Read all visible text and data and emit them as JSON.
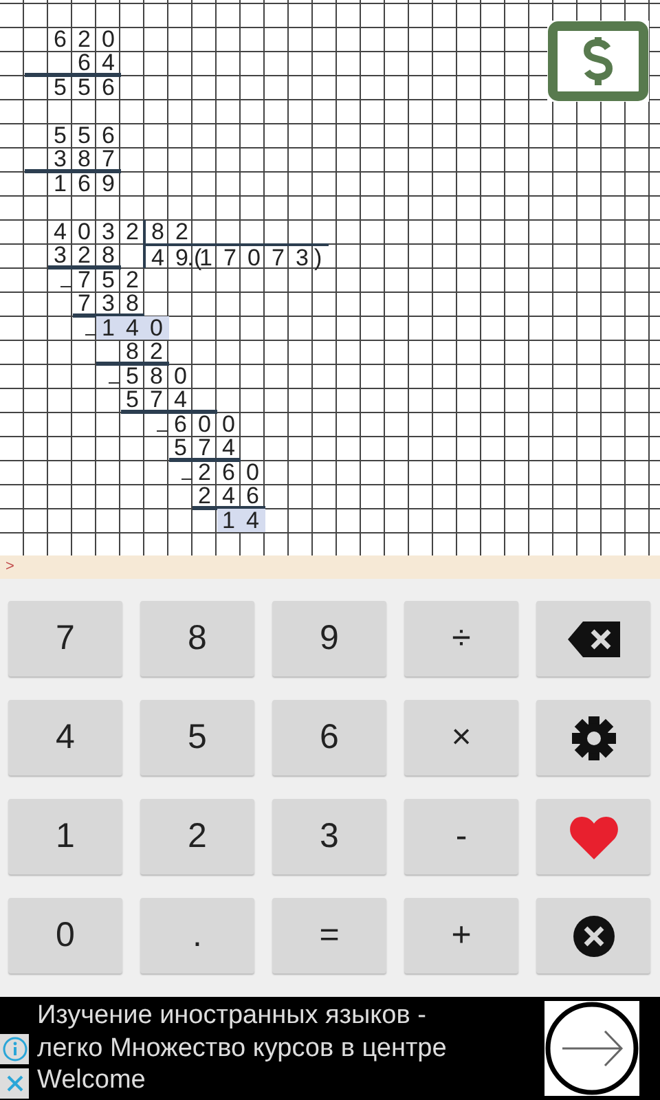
{
  "worksheet": {
    "rows": [
      {
        "kind": "blank"
      },
      {
        "kind": "line",
        "pieces": [
          {
            "text": "  6 2 0",
            "kind": "digits",
            "highlighted": false
          }
        ]
      },
      {
        "kind": "line",
        "pieces": [
          {
            "text": "   6 4",
            "kind": "digits",
            "highlighted": false
          }
        ],
        "underline": [
          false,
          true,
          true,
          true,
          true
        ]
      },
      {
        "kind": "line",
        "pieces": [
          {
            "text": "  5 5 6",
            "kind": "digits",
            "highlighted": false
          }
        ]
      },
      {
        "kind": "blank"
      },
      {
        "kind": "line",
        "pieces": [
          {
            "text": "  5 5 6",
            "kind": "digits",
            "highlighted": false
          }
        ]
      },
      {
        "kind": "line",
        "pieces": [
          {
            "text": "  3 8 7",
            "kind": "digits",
            "highlighted": false
          }
        ],
        "underline": [
          false,
          true,
          true,
          true,
          true
        ]
      },
      {
        "kind": "line",
        "pieces": [
          {
            "text": "  1 6 9",
            "kind": "digits",
            "highlighted": false
          }
        ]
      },
      {
        "kind": "blank"
      },
      {
        "kind": "line",
        "pieces": [
          {
            "text": "  4 0 3 2",
            "kind": "digits",
            "highlighted": false
          },
          {
            "text": "      8 2",
            "kind": "divisor",
            "highlighted": false
          }
        ]
      },
      {
        "kind": "line",
        "pieces": [
          {
            "text": "  3 2 8",
            "kind": "digits",
            "highlighted": false
          },
          {
            "text": "      4 9.(1 7 0 7 3)",
            "kind": "quotient",
            "highlighted": false
          }
        ],
        "underline": [
          false,
          false,
          true,
          true,
          true
        ]
      },
      {
        "kind": "line",
        "minus": true,
        "pieces": [
          {
            "text": "   7 5 2",
            "kind": "digits",
            "highlighted": false
          }
        ]
      },
      {
        "kind": "line",
        "pieces": [
          {
            "text": "   7 3 8",
            "kind": "digits",
            "highlighted": false
          }
        ],
        "underline": [
          false,
          false,
          false,
          true,
          true,
          true
        ]
      },
      {
        "kind": "line",
        "minus": true,
        "pieces": [
          {
            "text": "    1 4 0",
            "kind": "digits",
            "highlighted": true
          }
        ]
      },
      {
        "kind": "line",
        "pieces": [
          {
            "text": "     8 2",
            "kind": "digits",
            "highlighted": false
          }
        ],
        "underline": [
          false,
          false,
          false,
          false,
          true,
          true,
          true
        ]
      },
      {
        "kind": "line",
        "minus": true,
        "pieces": [
          {
            "text": "     5 8 0",
            "kind": "digits",
            "highlighted": false
          }
        ]
      },
      {
        "kind": "line",
        "pieces": [
          {
            "text": "     5 7 4",
            "kind": "digits",
            "highlighted": false
          }
        ],
        "underline": [
          false,
          false,
          false,
          false,
          false,
          true,
          true,
          true,
          true
        ]
      },
      {
        "kind": "line",
        "minus": true,
        "pieces": [
          {
            "text": "       6 0 0",
            "kind": "digits",
            "highlighted": false
          }
        ]
      },
      {
        "kind": "line",
        "pieces": [
          {
            "text": "       5 7 4",
            "kind": "digits",
            "highlighted": false
          }
        ],
        "underline": [
          false,
          false,
          false,
          false,
          false,
          false,
          false,
          true,
          true,
          true
        ]
      },
      {
        "kind": "line",
        "minus": true,
        "pieces": [
          {
            "text": "        2 6 0",
            "kind": "digits",
            "highlighted": false
          }
        ]
      },
      {
        "kind": "line",
        "pieces": [
          {
            "text": "        2 4 6",
            "kind": "digits",
            "highlighted": false
          }
        ],
        "underline": [
          false,
          false,
          false,
          false,
          false,
          false,
          false,
          false,
          true,
          true,
          true
        ]
      },
      {
        "kind": "line",
        "pieces": [
          {
            "text": "         1 4",
            "kind": "digits",
            "highlighted": true
          }
        ]
      }
    ]
  },
  "input": {
    "prompt": ">"
  },
  "keypad": [
    {
      "kind": "text",
      "label": "7"
    },
    {
      "kind": "text",
      "label": "8"
    },
    {
      "kind": "text",
      "label": "9"
    },
    {
      "kind": "text",
      "label": "÷"
    },
    {
      "kind": "backspace"
    },
    {
      "kind": "text",
      "label": "4"
    },
    {
      "kind": "text",
      "label": "5"
    },
    {
      "kind": "text",
      "label": "6"
    },
    {
      "kind": "text",
      "label": "×"
    },
    {
      "kind": "settings"
    },
    {
      "kind": "text",
      "label": "1"
    },
    {
      "kind": "text",
      "label": "2"
    },
    {
      "kind": "text",
      "label": "3"
    },
    {
      "kind": "text",
      "label": "-"
    },
    {
      "kind": "heart"
    },
    {
      "kind": "text",
      "label": "0"
    },
    {
      "kind": "text",
      "label": "."
    },
    {
      "kind": "text",
      "label": "="
    },
    {
      "kind": "text",
      "label": "+"
    },
    {
      "kind": "clear"
    }
  ],
  "ad": {
    "lines": [
      "Изучение иностранных языков -",
      "легко Множество курсов в центре",
      "Welcome"
    ]
  }
}
